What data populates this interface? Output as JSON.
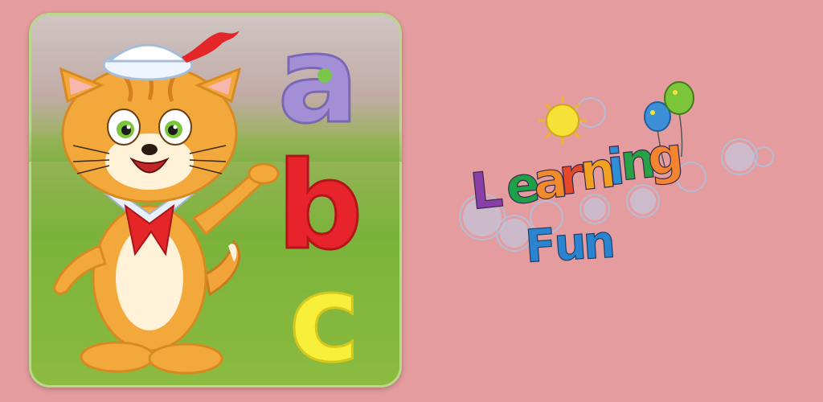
{
  "background_color": "#e49c9e",
  "icon_card": {
    "letters": [
      {
        "char": "a",
        "color": "#a38fd6"
      },
      {
        "char": "b",
        "color": "#e7232b"
      },
      {
        "char": "c",
        "color": "#f7ef3a"
      }
    ]
  },
  "title": {
    "line1": "Learning",
    "line2": "Fun",
    "line1_colors": [
      "#8a3ea8",
      "#1e9f4a",
      "#f08a2a",
      "#e6482a",
      "#f2a01f",
      "#2f8fd6",
      "#27a046",
      "#f5842f"
    ],
    "line2_colors": [
      "#2a84d0",
      "#2a84d0",
      "#2a84d0"
    ]
  },
  "decorations": {
    "sun_icon": "sun-icon",
    "balloons_icon": "balloons-icon"
  }
}
